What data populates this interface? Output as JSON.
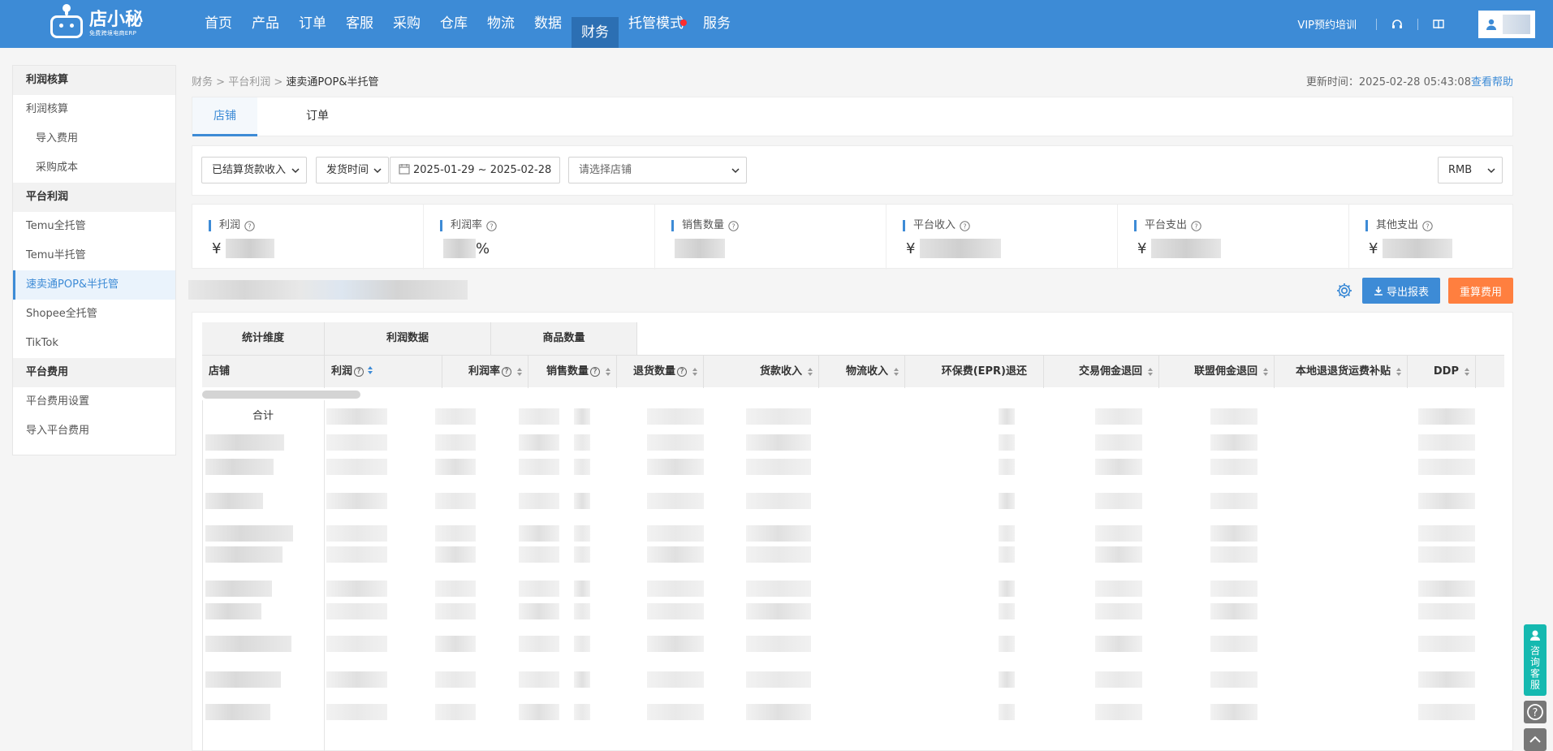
{
  "app": {
    "logo_main": "店小秘",
    "logo_sub": "免费跨境电商ERP"
  },
  "nav": {
    "items": [
      {
        "label": "首页"
      },
      {
        "label": "产品"
      },
      {
        "label": "订单"
      },
      {
        "label": "客服"
      },
      {
        "label": "采购"
      },
      {
        "label": "仓库"
      },
      {
        "label": "物流"
      },
      {
        "label": "数据"
      },
      {
        "label": "财务"
      },
      {
        "label": "托管模式"
      },
      {
        "label": "服务"
      }
    ],
    "active": "财务",
    "vip_label": "VIP预约培训"
  },
  "sidebar": {
    "groups": [
      {
        "title": "利润核算",
        "items": [
          {
            "label": "利润核算"
          },
          {
            "label": "导入费用"
          },
          {
            "label": "采购成本"
          }
        ]
      },
      {
        "title": "平台利润",
        "items": [
          {
            "label": "Temu全托管"
          },
          {
            "label": "Temu半托管"
          },
          {
            "label": "速卖通POP&半托管"
          },
          {
            "label": "Shopee全托管"
          },
          {
            "label": "TikTok"
          }
        ]
      },
      {
        "title": "平台费用",
        "items": [
          {
            "label": "平台费用设置"
          },
          {
            "label": "导入平台费用"
          }
        ]
      }
    ],
    "active_item": "速卖通POP&半托管"
  },
  "breadcrumb": {
    "items": [
      "财务",
      "平台利润"
    ],
    "current": "速卖通POP&半托管",
    "separator": ">"
  },
  "update": {
    "label": "更新时间：",
    "time": "2025-02-28 05:43:08",
    "help": "查看帮助"
  },
  "tabs": [
    {
      "label": "店铺",
      "active": true
    },
    {
      "label": "订单",
      "active": false
    }
  ],
  "filters": {
    "income_type": "已结算货款收入",
    "time_type": "发货时间",
    "date_range": "2025-01-29 ~ 2025-02-28",
    "shop_placeholder": "请选择店铺",
    "currency": "RMB"
  },
  "stats": [
    {
      "label": "利润",
      "prefix": "¥",
      "suffix": ""
    },
    {
      "label": "利润率",
      "prefix": "",
      "suffix": "%"
    },
    {
      "label": "销售数量",
      "prefix": "",
      "suffix": ""
    },
    {
      "label": "平台收入",
      "prefix": "¥",
      "suffix": ""
    },
    {
      "label": "平台支出",
      "prefix": "¥",
      "suffix": ""
    },
    {
      "label": "其他支出",
      "prefix": "¥",
      "suffix": ""
    }
  ],
  "actions": {
    "export": "导出报表",
    "recalc": "重算费用"
  },
  "table": {
    "group_headers": [
      "统计维度",
      "利润数据",
      "商品数量"
    ],
    "columns": [
      "店铺",
      "利润",
      "利润率",
      "销售数量",
      "退货数量",
      "货款收入",
      "物流收入",
      "环保费(EPR)退还",
      "交易佣金退回",
      "联盟佣金退回",
      "本地退退货运费补贴",
      "DDP"
    ],
    "total_label": "合计"
  },
  "float": {
    "consult": "咨询客服"
  },
  "colors": {
    "primary": "#3d8bd6",
    "orange": "#ff7f3f",
    "teal": "#15b9b0"
  }
}
